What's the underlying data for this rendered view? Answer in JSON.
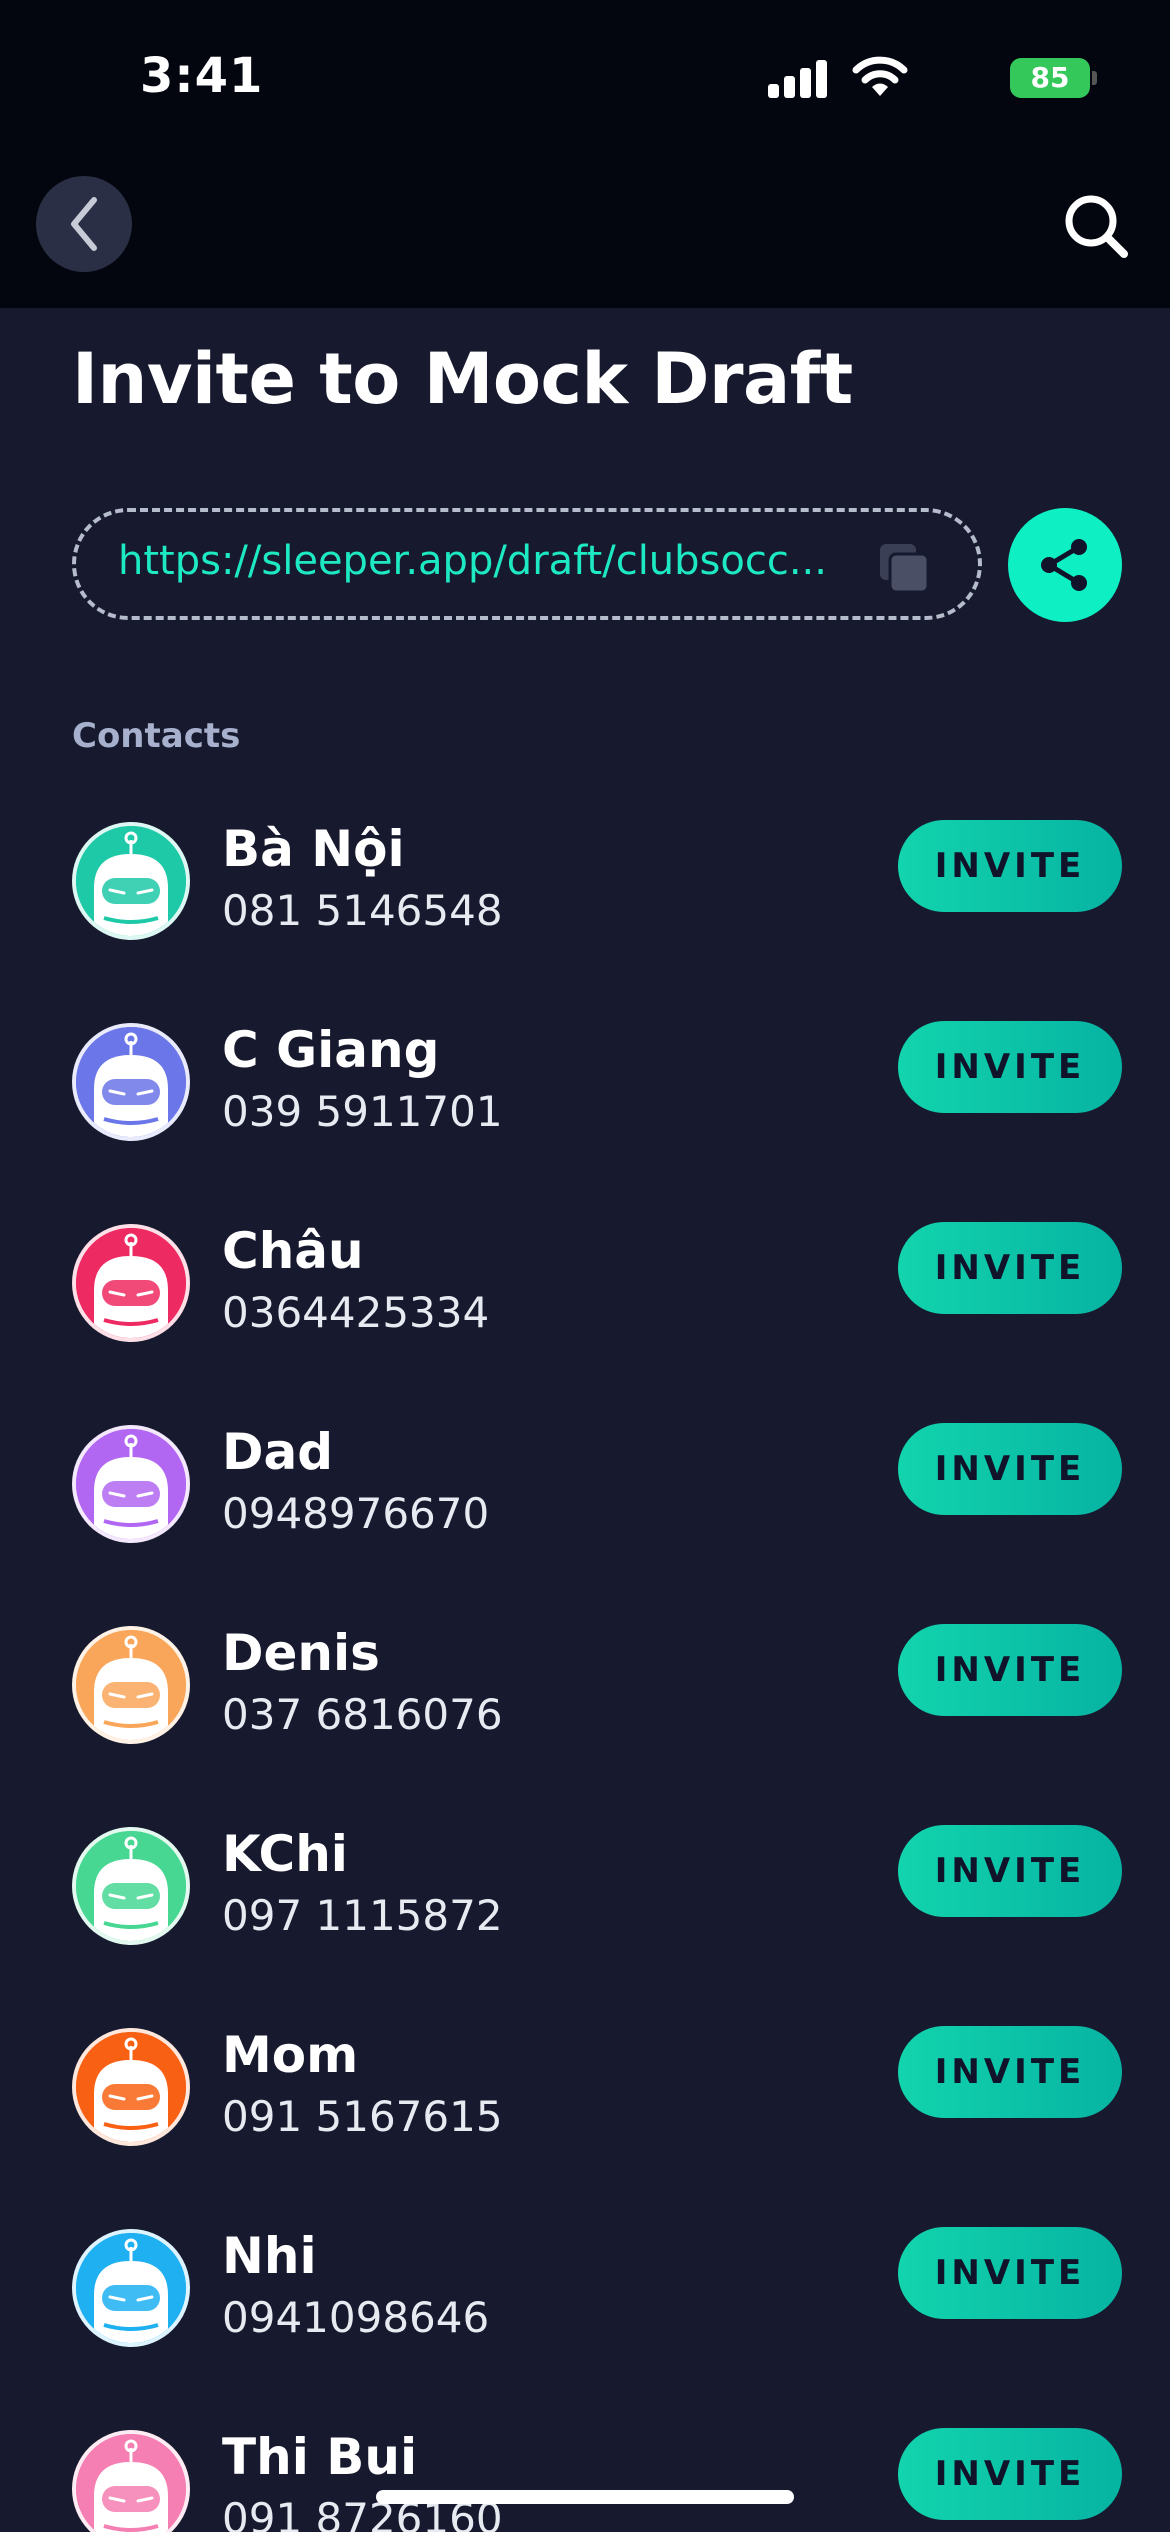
{
  "status_bar": {
    "time": "3:41",
    "battery": "85"
  },
  "header": {
    "title": "Invite to Mock Draft"
  },
  "invite_link": {
    "url": "https://sleeper.app/draft/clubsocc..."
  },
  "icons": {
    "back": "chevron-left-icon",
    "search": "search-icon",
    "copy": "copy-icon",
    "share": "share-icon"
  },
  "colors": {
    "accent": "#0ef0c3",
    "background": "#171a2e",
    "header": "#03050f"
  },
  "section": {
    "contacts_label": "Contacts"
  },
  "contacts": [
    {
      "name": "Bà Nội",
      "phone": "081 5146548",
      "avatar_color": "#1ec9a8",
      "invite_label": "INVITE"
    },
    {
      "name": "C Giang",
      "phone": "039 5911701",
      "avatar_color": "#6b76e8",
      "invite_label": "INVITE"
    },
    {
      "name": "Châu",
      "phone": "0364425334",
      "avatar_color": "#ee2a62",
      "invite_label": "INVITE"
    },
    {
      "name": "Dad",
      "phone": "0948976670",
      "avatar_color": "#b267f2",
      "invite_label": "INVITE"
    },
    {
      "name": "Denis",
      "phone": "037 6816076",
      "avatar_color": "#f9a65a",
      "invite_label": "INVITE"
    },
    {
      "name": "KChi",
      "phone": "097 1115872",
      "avatar_color": "#47d793",
      "invite_label": "INVITE"
    },
    {
      "name": "Mom",
      "phone": "091 5167615",
      "avatar_color": "#f86114",
      "invite_label": "INVITE"
    },
    {
      "name": "Nhi",
      "phone": "0941098646",
      "avatar_color": "#1fb0f2",
      "invite_label": "INVITE"
    },
    {
      "name": "Thi Bui",
      "phone": "091 8726160",
      "avatar_color": "#f57eb2",
      "invite_label": "INVITE"
    }
  ]
}
